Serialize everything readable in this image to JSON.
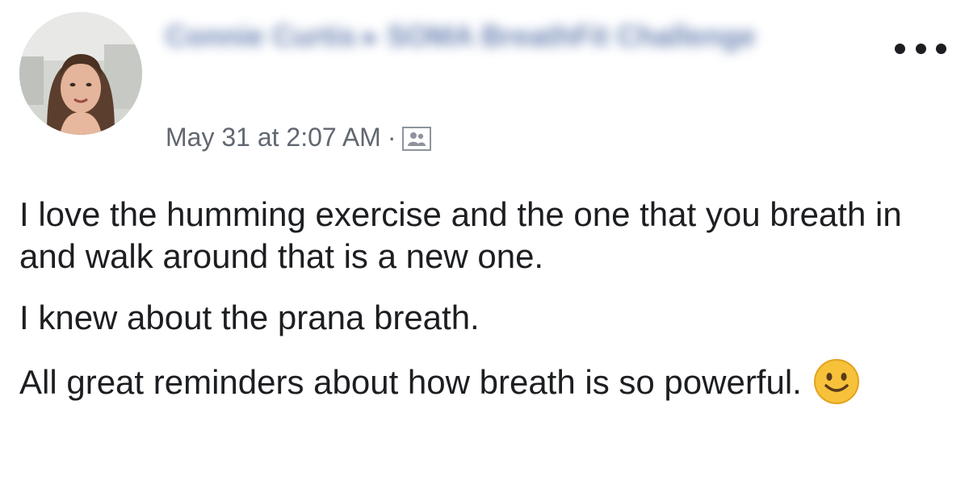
{
  "post": {
    "author_name": "Connie Curtis",
    "separator": "▸",
    "group_name": "SOMA BreathFit Challenge",
    "timestamp": "May 31 at 2:07 AM",
    "meta_dot": "·",
    "audience_icon": "group-audience-icon",
    "more_icon": "ellipsis-icon",
    "paragraphs": [
      "I love the humming exercise and the one that you breath in and walk around that is a new one.",
      "I knew about the prana breath.",
      "All great reminders about how breath is so powerful."
    ],
    "emoji": "slightly-smiling-face-icon"
  },
  "colors": {
    "text": "#1c1e21",
    "meta": "#616770",
    "link": "#385898",
    "emoji_face": "#f7c13a"
  }
}
